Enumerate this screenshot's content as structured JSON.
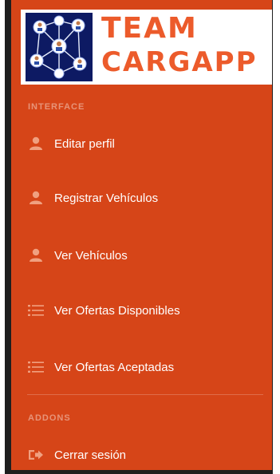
{
  "brand": {
    "line1": "TEAM",
    "line2": "CARGAPP"
  },
  "sections": {
    "interface": "INTERFACE",
    "addons": "ADDONS"
  },
  "nav": {
    "edit_profile": "Editar perfil",
    "register_vehicles": "Registrar Vehículos",
    "view_vehicles": "Ver Vehículos",
    "available_offers": "Ver Ofertas Disponibles",
    "accepted_offers": "Ver Ofertas Aceptadas",
    "logout": "Cerrar sesión"
  },
  "colors": {
    "sidebar_bg": "#d64518",
    "icon_muted": "#f0a080",
    "brand_text": "#ec5b2b",
    "logo_bg": "#0d1a63"
  },
  "icons": {
    "edit_profile": "user-icon",
    "register_vehicles": "user-icon",
    "view_vehicles": "user-icon",
    "available_offers": "list-icon",
    "accepted_offers": "list-icon",
    "logout": "sign-out-icon"
  }
}
